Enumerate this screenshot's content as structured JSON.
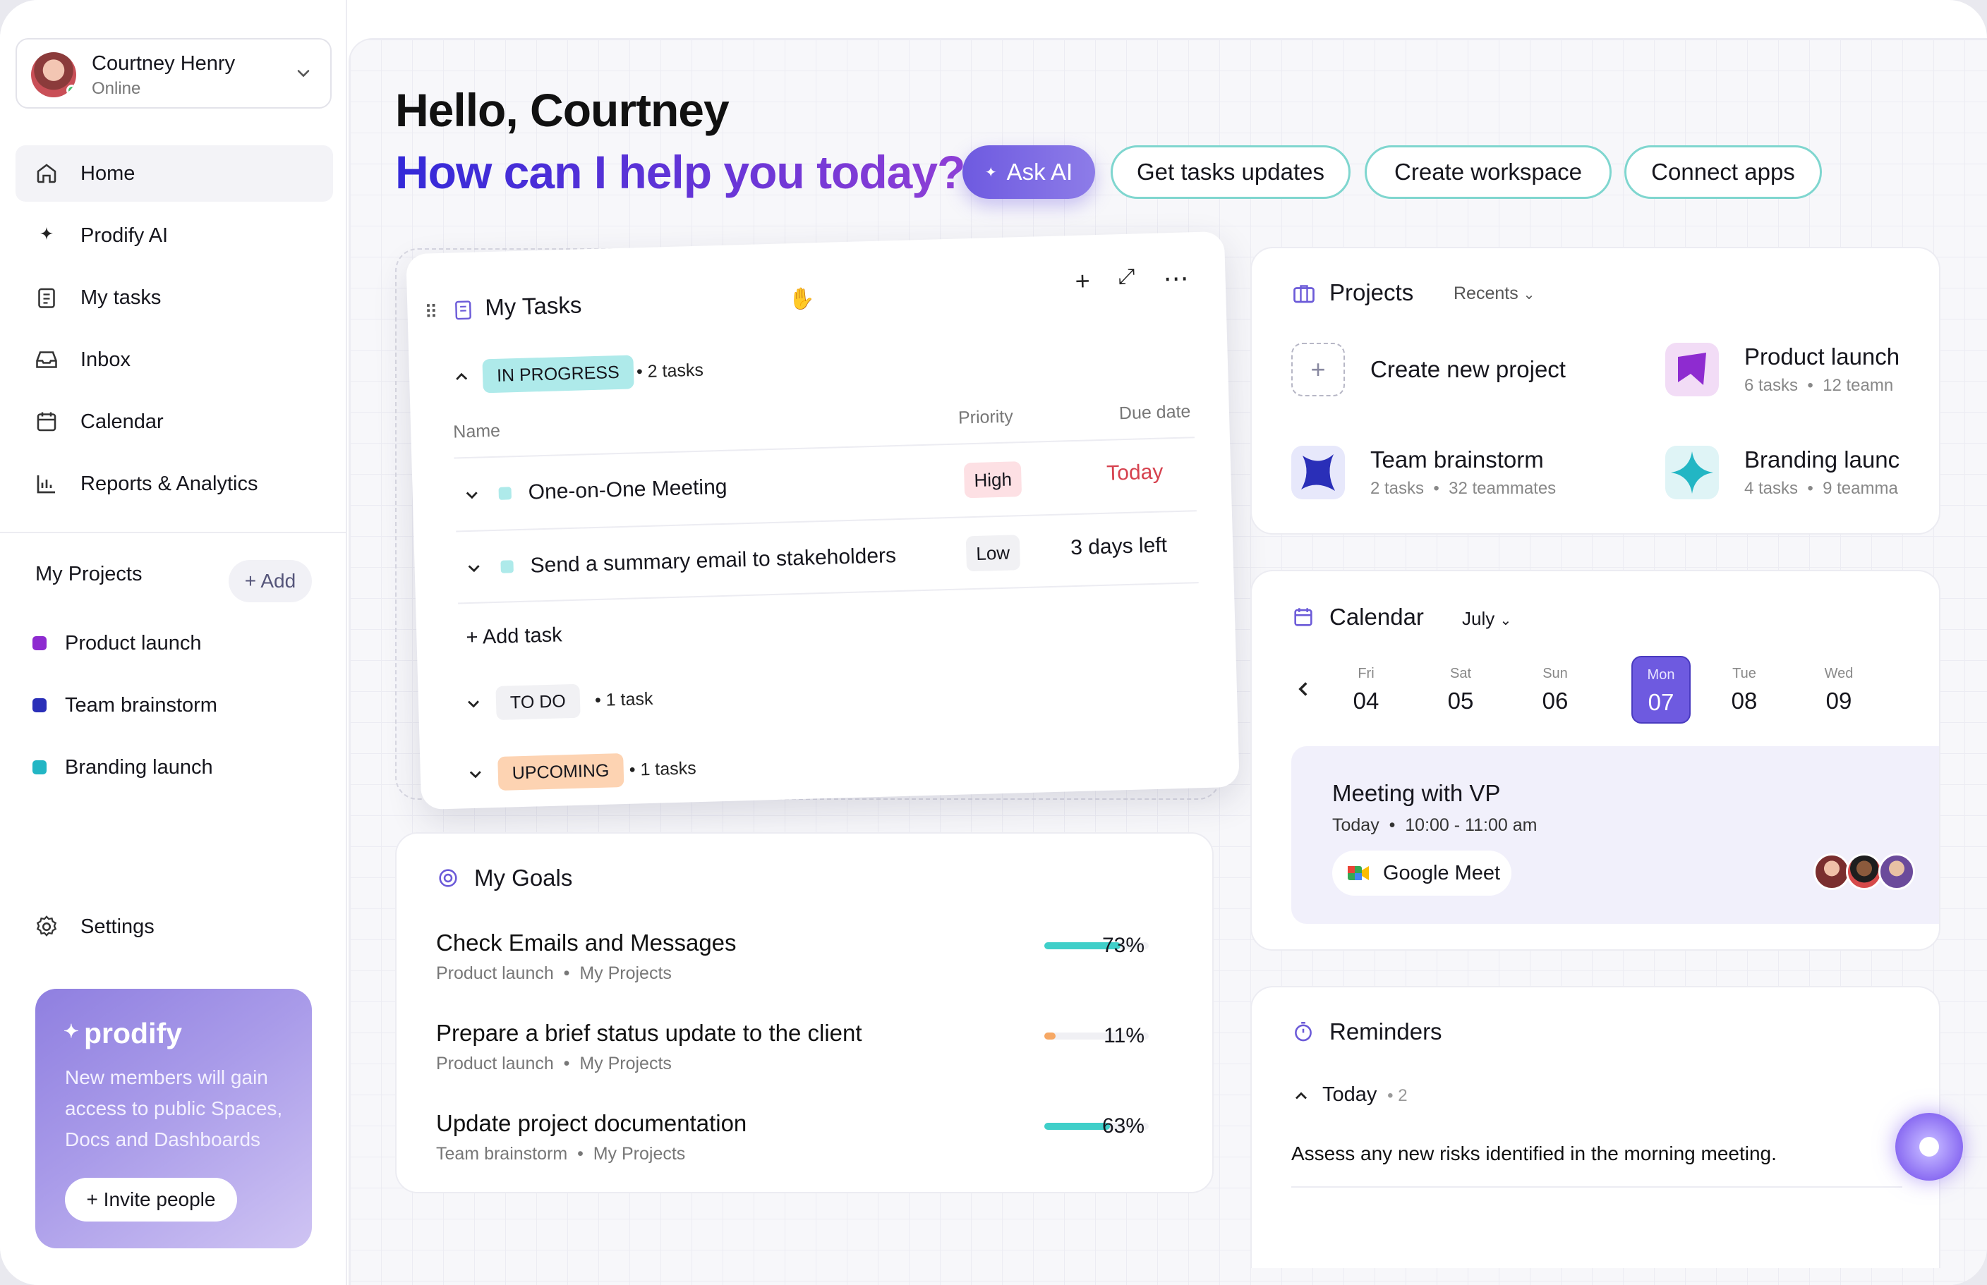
{
  "user": {
    "name": "Courtney Henry",
    "status": "Online"
  },
  "nav": [
    {
      "label": "Home",
      "icon": "home-icon"
    },
    {
      "label": "Prodify AI",
      "icon": "sparkle-icon"
    },
    {
      "label": "My tasks",
      "icon": "clipboard-icon"
    },
    {
      "label": "Inbox",
      "icon": "inbox-icon"
    },
    {
      "label": "Calendar",
      "icon": "calendar-icon"
    },
    {
      "label": "Reports & Analytics",
      "icon": "bar-chart-icon"
    }
  ],
  "my_projects": {
    "heading": "My Projects",
    "add_label": "+ Add",
    "items": [
      {
        "label": "Product launch",
        "color": "#8e2bd0"
      },
      {
        "label": "Team brainstorm",
        "color": "#2a2fb8"
      },
      {
        "label": "Branding launch",
        "color": "#22b6c4"
      }
    ]
  },
  "settings_label": "Settings",
  "promo": {
    "logo": "prodify",
    "text": "New members will gain access to public Spaces, Docs and Dashboards",
    "button": "+ Invite people"
  },
  "greeting": {
    "line1": "Hello, Courtney",
    "line2": "How can I help you today?"
  },
  "actions": {
    "ask_ai": "Ask AI",
    "get_updates": "Get tasks updates",
    "create_workspace": "Create workspace",
    "connect_apps": "Connect apps"
  },
  "tasks": {
    "title": "My Tasks",
    "in_progress": {
      "label": "IN PROGRESS",
      "count": "2 tasks"
    },
    "columns": {
      "name": "Name",
      "priority": "Priority",
      "due": "Due date"
    },
    "rows": [
      {
        "name": "One-on-One Meeting",
        "priority": "High",
        "due": "Today"
      },
      {
        "name": "Send a summary email to stakeholders",
        "priority": "Low",
        "due": "3 days left"
      }
    ],
    "add_task": "+ Add task",
    "todo": {
      "label": "TO DO",
      "count": "1 task"
    },
    "upcoming": {
      "label": "UPCOMING",
      "count": "1 tasks"
    }
  },
  "goals": {
    "title": "My Goals",
    "items": [
      {
        "title": "Check Emails and Messages",
        "project": "Product launch",
        "group": "My Projects",
        "percent": "73%",
        "progress": 0.73,
        "color": "#3fcfc9"
      },
      {
        "title": "Prepare a brief status update to the client",
        "project": "Product launch",
        "group": "My Projects",
        "percent": "11%",
        "progress": 0.11,
        "color": "#f6a865"
      },
      {
        "title": "Update project documentation",
        "project": "Team brainstorm",
        "group": "My Projects",
        "percent": "63%",
        "progress": 0.63,
        "color": "#3fcfc9"
      }
    ]
  },
  "projects": {
    "title": "Projects",
    "filter": "Recents",
    "create_label": "Create new project",
    "items": [
      {
        "name": "Product launch",
        "tasks": "6 tasks",
        "team": "12 teamn"
      },
      {
        "name": "Team brainstorm",
        "tasks": "2 tasks",
        "team": "32 teammates"
      },
      {
        "name": "Branding launc",
        "tasks": "4 tasks",
        "team": "9 teamma"
      }
    ]
  },
  "calendar": {
    "title": "Calendar",
    "month": "July",
    "days": [
      {
        "name": "Fri",
        "num": "04"
      },
      {
        "name": "Sat",
        "num": "05"
      },
      {
        "name": "Sun",
        "num": "06"
      },
      {
        "name": "Mon",
        "num": "07"
      },
      {
        "name": "Tue",
        "num": "08"
      },
      {
        "name": "Wed",
        "num": "09"
      }
    ],
    "meeting": {
      "title": "Meeting with VP",
      "day": "Today",
      "time": "10:00 - 11:00 am",
      "app": "Google Meet"
    }
  },
  "reminders": {
    "title": "Reminders",
    "group": "Today",
    "count": "2",
    "text": "Assess any new risks identified in the morning meeting."
  }
}
